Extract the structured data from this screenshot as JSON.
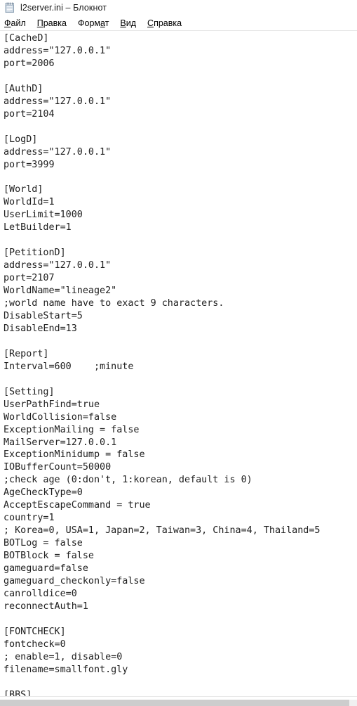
{
  "window": {
    "title": "l2server.ini – Блокнот",
    "icon": "notepad-icon"
  },
  "menubar": {
    "items": [
      {
        "label": "Файл",
        "mnemonic_index": 0
      },
      {
        "label": "Правка",
        "mnemonic_index": 0
      },
      {
        "label": "Формат",
        "mnemonic_index": 4
      },
      {
        "label": "Вид",
        "mnemonic_index": 0
      },
      {
        "label": "Справка",
        "mnemonic_index": 0
      }
    ]
  },
  "editor": {
    "filename": "l2server.ini",
    "content": "[CacheD]\naddress=\"127.0.0.1\"\nport=2006\n\n[AuthD]\naddress=\"127.0.0.1\"\nport=2104\n\n[LogD]\naddress=\"127.0.0.1\"\nport=3999\n\n[World]\nWorldId=1\nUserLimit=1000\nLetBuilder=1\n\n[PetitionD]\naddress=\"127.0.0.1\"\nport=2107\nWorldName=\"lineage2\"\n;world name have to exact 9 characters.\nDisableStart=5\nDisableEnd=13\n\n[Report]\nInterval=600    ;minute\n\n[Setting]\nUserPathFind=true\nWorldCollision=false\nExceptionMailing = false\nMailServer=127.0.0.1\nExceptionMinidump = false\nIOBufferCount=50000\n;check age (0:don't, 1:korean, default is 0)\nAgeCheckType=0\nAcceptEscapeCommand = true\ncountry=1\n; Korea=0, USA=1, Japan=2, Taiwan=3, China=4, Thailand=5\nBOTLog = false\nBOTBlock = false\ngameguard=false\ngameguard_checkonly=false\ncanrolldice=0\nreconnectAuth=1\n\n[FONTCHECK]\nfontcheck=0\n; enable=1, disable=0\nfilename=smallfont.gly\n\n[BBS]"
  },
  "scrollbar": {
    "orientation": "horizontal",
    "thumb_color": "#cdcdcd",
    "track_color": "#f0f0f0"
  }
}
